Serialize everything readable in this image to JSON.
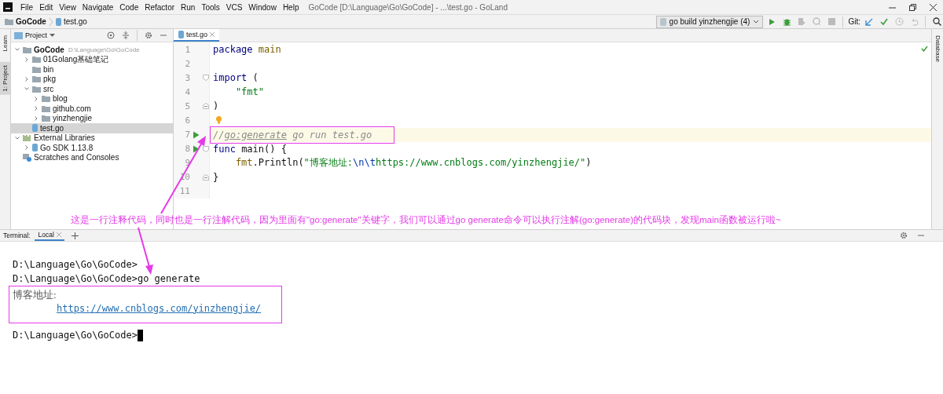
{
  "title_bar": {
    "menu": [
      "File",
      "Edit",
      "View",
      "Navigate",
      "Code",
      "Refactor",
      "Run",
      "Tools",
      "VCS",
      "Window",
      "Help"
    ],
    "title": "GoCode [D:\\Language\\Go\\GoCode] - ...\\test.go - GoLand"
  },
  "nav_bar": {
    "breadcrumb": [
      "GoCode",
      "test.go"
    ],
    "run_config": "go build yinzhengjie (4)",
    "git_label": "Git:"
  },
  "left_strip": {
    "tabs": [
      {
        "label": "Learn",
        "selected": false
      },
      {
        "label": "1: Project",
        "selected": true
      }
    ]
  },
  "right_strip": {
    "tabs": [
      {
        "label": "Database",
        "selected": false
      }
    ]
  },
  "project_panel": {
    "title": "Project",
    "tree": [
      {
        "label": "GoCode",
        "path": "D:\\Language\\Go\\GoCode",
        "kind": "module",
        "expanded": true,
        "selected": false,
        "children": [
          {
            "label": "01Golang基础笔记",
            "kind": "folder",
            "expanded": false,
            "selected": false
          },
          {
            "label": "bin",
            "kind": "folder",
            "selected": false
          },
          {
            "label": "pkg",
            "kind": "folder",
            "expanded": false,
            "selected": false
          },
          {
            "label": "src",
            "kind": "folder",
            "expanded": true,
            "selected": false,
            "children": [
              {
                "label": "blog",
                "kind": "folder",
                "expanded": false,
                "selected": false
              },
              {
                "label": "github.com",
                "kind": "folder",
                "expanded": false,
                "selected": false
              },
              {
                "label": "yinzhengjie",
                "kind": "folder",
                "expanded": false,
                "selected": false
              }
            ]
          },
          {
            "label": "test.go",
            "kind": "file",
            "selected": true
          }
        ]
      },
      {
        "label": "External Libraries",
        "kind": "library",
        "expanded": true,
        "selected": false,
        "children": [
          {
            "label": "Go SDK 1.13.8",
            "kind": "sdk",
            "expanded": false,
            "selected": false
          }
        ]
      },
      {
        "label": "Scratches and Consoles",
        "kind": "scratches",
        "selected": false
      }
    ]
  },
  "editor": {
    "tabs": [
      {
        "label": "test.go",
        "selected": true
      }
    ],
    "lines": [
      {
        "number": "1",
        "current": false,
        "boxed": false,
        "tokens": [
          {
            "text": "package",
            "kind": "keyword"
          },
          {
            "text": " main",
            "kind": "package"
          }
        ]
      },
      {
        "number": "2",
        "current": false
      },
      {
        "number": "3",
        "current": false,
        "boxed": false,
        "markers": [
          {
            "kind": "fold_start"
          }
        ],
        "tokens": [
          {
            "text": "import",
            "kind": "keyword"
          },
          {
            "text": " (",
            "kind": "plain"
          }
        ]
      },
      {
        "number": "4",
        "current": false,
        "boxed": false,
        "tokens": [
          {
            "text": "    \"fmt\"",
            "kind": "string"
          }
        ]
      },
      {
        "number": "5",
        "current": false,
        "boxed": false,
        "markers": [
          {
            "kind": "fold_end"
          }
        ],
        "tokens": [
          {
            "text": ")",
            "kind": "plain"
          }
        ]
      },
      {
        "number": "6",
        "current": false,
        "markers": [
          {
            "kind": "bulb"
          }
        ]
      },
      {
        "number": "7",
        "current": true,
        "boxed": true,
        "markers": [
          {
            "kind": "run"
          }
        ],
        "tokens": [
          {
            "text": "//",
            "kind": "comment"
          },
          {
            "text": "go:generate",
            "kind": "directive"
          },
          {
            "text": " go run test.go",
            "kind": "comment"
          }
        ]
      },
      {
        "number": "8",
        "current": false,
        "boxed": false,
        "markers": [
          {
            "kind": "run"
          },
          {
            "kind": "fold_start"
          }
        ],
        "tokens": [
          {
            "text": "func",
            "kind": "keyword"
          },
          {
            "text": " main() {",
            "kind": "plain"
          }
        ]
      },
      {
        "number": "9",
        "current": false,
        "boxed": false,
        "tokens": [
          {
            "text": "    fmt",
            "kind": "package"
          },
          {
            "text": ".Println(",
            "kind": "plain"
          },
          {
            "text": "\"博客地址:",
            "kind": "string"
          },
          {
            "text": "\\n\\t",
            "kind": "escape"
          },
          {
            "text": "https://www.cnblogs.com/yinzhengjie/\"",
            "kind": "string"
          },
          {
            "text": ")",
            "kind": "plain"
          }
        ]
      },
      {
        "number": "10",
        "current": false,
        "boxed": false,
        "markers": [
          {
            "kind": "fold_end"
          }
        ],
        "tokens": [
          {
            "text": "}",
            "kind": "plain"
          }
        ]
      },
      {
        "number": "11",
        "current": false
      }
    ]
  },
  "annotation": {
    "text": "这是一行注释代码，同时也是一行注解代码，因为里面有\"go:generate\"关键字，我们可以通过go generate命令可以执行注解(go:generate)的代码块，发现main函数被运行啦~"
  },
  "terminal": {
    "label": "Terminal:",
    "tabs": [
      {
        "label": "Local",
        "selected": true
      }
    ],
    "entries": [
      {
        "kind": "prompt",
        "text": "D:\\Language\\Go\\GoCode>",
        "cursor": false
      },
      {
        "kind": "prompt",
        "text": "D:\\Language\\Go\\GoCode>go generate",
        "cursor": false
      },
      {
        "kind": "output",
        "boxed": true,
        "lines": [
          {
            "kind": "text",
            "text": "博客地址:"
          },
          {
            "kind": "link",
            "text": "https://www.cnblogs.com/yinzhengjie/"
          }
        ]
      },
      {
        "kind": "prompt",
        "text": "D:\\Language\\Go\\GoCode>",
        "cursor": true
      }
    ]
  }
}
